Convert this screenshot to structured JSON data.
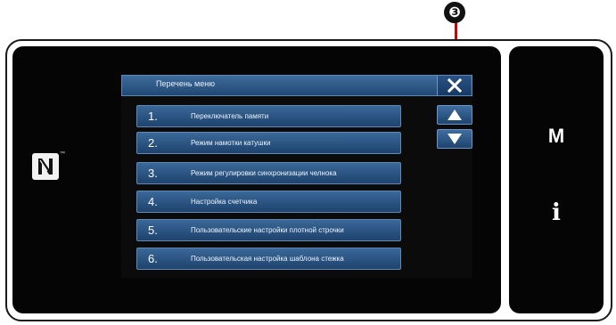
{
  "callout": {
    "number": "❸"
  },
  "device": {
    "nfc_icon": "nfc-icon",
    "nfc_tm": "™",
    "side_buttons": {
      "m_label": "M",
      "info_label": "i"
    }
  },
  "menu": {
    "title": "Перечень меню",
    "close_icon": "close-icon",
    "scroll_up_icon": "triangle-up-icon",
    "scroll_down_icon": "triangle-down-icon",
    "items": [
      {
        "number": "1.",
        "label": "Переключатель памяти"
      },
      {
        "number": "2.",
        "label": "Режим намотки катушки"
      },
      {
        "number": "3.",
        "label": "Режим регулировки синхронизации челнока"
      },
      {
        "number": "4.",
        "label": "Настройка счетчика"
      },
      {
        "number": "5.",
        "label": "Пользовательские настройки плотной строчки"
      },
      {
        "number": "6.",
        "label": "Пользовательская настройка шаблона стежка"
      }
    ]
  },
  "colors": {
    "accent_blue": "#2f5e90",
    "callout_red": "#d40000",
    "screen_black": "#050505"
  }
}
